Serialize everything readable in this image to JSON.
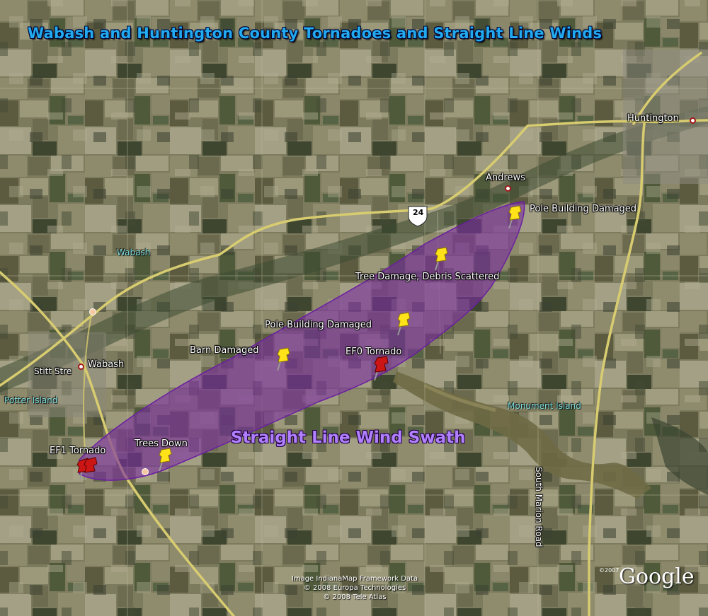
{
  "title": "Wabash and Huntington County Tornadoes and Straight Line Winds",
  "swath_label": "Straight Line Wind Swath",
  "places": {
    "huntington": "Huntington",
    "andrews": "Andrews",
    "wabash_town": "Wabash",
    "wabash_region": "Wabash",
    "stitt": "Stitt Stre",
    "potter": "Potter Island",
    "monument": "Monument Island",
    "south_marion": "South Marion Road"
  },
  "highway_shield": "24",
  "markers": {
    "pole1": "Pole Building Damaged",
    "tree_damage": "Tree Damage, Debris Scattered",
    "pole2": "Pole Building Damaged",
    "barn": "Barn Damaged",
    "ef0": "EF0 Tornado",
    "ef1": "EF1 Tornado",
    "trees_down": "Trees Down"
  },
  "credits": {
    "line1": "Image IndianaMap Framework Data",
    "line2": "© 2008 Europa Technologies",
    "line3": "© 2008 Tele Atlas",
    "year": "©2007",
    "logo": "Google"
  },
  "colors": {
    "swath_fill": "#7a2fa0",
    "swath_edge": "#6a1fa0",
    "road": "#d8cc70",
    "pin_yellow": "#ffe21a",
    "pin_red": "#cc1616"
  }
}
